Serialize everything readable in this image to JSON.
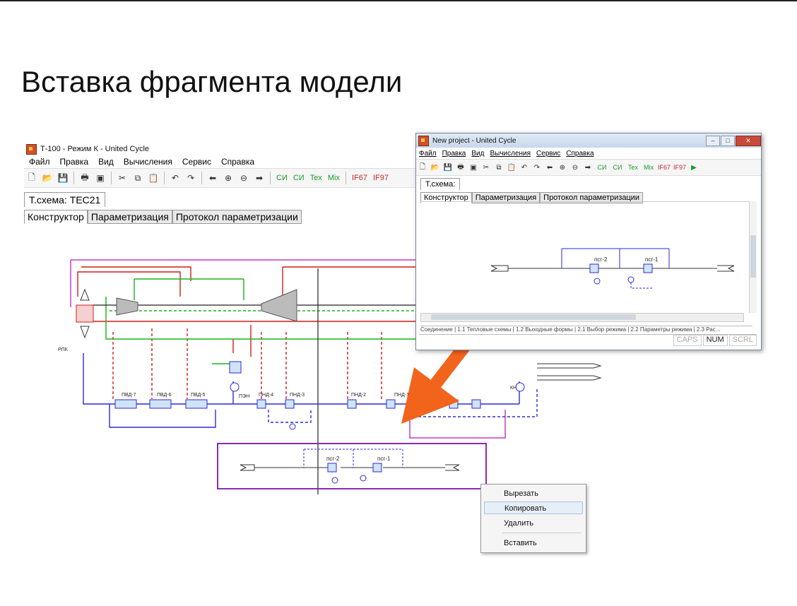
{
  "slide": {
    "title": "Вставка фрагмента модели"
  },
  "main_window": {
    "title": "Т-100 - Режим К - United Cycle",
    "menu": [
      "Файл",
      "Правка",
      "Вид",
      "Вычисления",
      "Сервис",
      "Справка"
    ],
    "toolbar_labels": {
      "si_mpa": "СИ",
      "si_bar": "СИ",
      "tex": "Tex",
      "mix": "Mix",
      "if67": "IF67",
      "if97": "IF97"
    },
    "schema_tab": "Т.схема: ТЕС21",
    "tabs": [
      "Конструктор",
      "Параметризация",
      "Протокол параметризации"
    ]
  },
  "diagram": {
    "labels": {
      "rpk": "РПК",
      "pvd7": "ПВД-7",
      "pvd6": "ПВД-6",
      "pvd5": "ПВД-5",
      "pen": "ПЭН",
      "pnd4": "ПНД-4",
      "pnd3": "ПНД-3",
      "pnd2": "ПНД-2",
      "pnd1": "ПНД-1",
      "kn": "КН",
      "psg2": "псг-2",
      "psg1": "псг-1"
    }
  },
  "overlay_window": {
    "title": "New project - United Cycle",
    "menu": [
      "Файл",
      "Правка",
      "Вид",
      "Вычисления",
      "Сервис",
      "Справка"
    ],
    "toolbar_labels": {
      "si_mpa": "СИ",
      "si_bar": "СИ",
      "tex": "Tex",
      "mix": "Mix",
      "if67": "IF67",
      "if97": "IF97"
    },
    "schema_tab": "Т.схема:",
    "tabs": [
      "Конструктор",
      "Параметризация",
      "Протокол параметризации"
    ],
    "diagram_labels": {
      "psg2": "псг-2",
      "psg1": "псг-1"
    },
    "bottom_tabs": "Соединение | 1.1 Тепловые схемы | 1.2 Выходные формы | 2.1 Выбор режима | 2.2 Параметры режима | 2.3 Рас...",
    "status": [
      "CAPS",
      "NUM",
      "SCRL"
    ]
  },
  "context_menu": {
    "items": [
      "Вырезать",
      "Копировать",
      "Удалить",
      "Вставить"
    ],
    "highlighted": "Копировать"
  },
  "colors": {
    "arrow": "#f2641c",
    "steam": "#d01c1c",
    "water": "#2a2ad8",
    "green": "#18b418",
    "magenta": "#c83ac8",
    "purple": "#8a2ab8"
  }
}
